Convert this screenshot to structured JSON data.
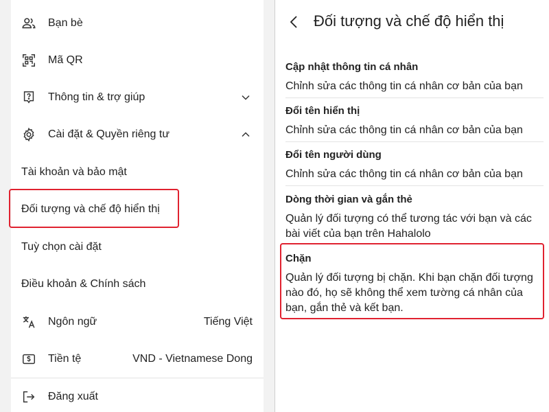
{
  "left_menu": {
    "friends": {
      "label": "Bạn bè",
      "icon": "friends-icon"
    },
    "qr": {
      "label": "Mã QR",
      "icon": "qr-code-icon"
    },
    "help": {
      "label": "Thông tin & trợ giúp",
      "icon": "help-icon"
    },
    "settings": {
      "label": "Cài đặt & Quyền riêng tư",
      "icon": "gear-icon"
    },
    "sub_account": {
      "label": "Tài khoản và bảo mật"
    },
    "sub_audience": {
      "label": "Đối tượng và chế độ hiển thị"
    },
    "sub_preferences": {
      "label": "Tuỳ chọn cài đặt"
    },
    "sub_terms": {
      "label": "Điều khoản & Chính sách"
    },
    "language": {
      "label": "Ngôn ngữ",
      "value": "Tiếng Việt",
      "icon": "translate-icon"
    },
    "currency": {
      "label": "Tiền tệ",
      "value": "VND - Vietnamese Dong",
      "icon": "currency-icon"
    },
    "logout": {
      "label": "Đăng xuất",
      "icon": "logout-icon"
    }
  },
  "right_panel": {
    "title": "Đối tượng và chế độ hiển thị",
    "sections": [
      {
        "title": "Cập nhật thông tin cá nhân",
        "desc": "Chỉnh sửa các thông tin cá nhân cơ bản của bạn"
      },
      {
        "title": "Đổi tên hiển thị",
        "desc": "Chỉnh sửa các thông tin cá nhân cơ bản của bạn"
      },
      {
        "title": "Đổi tên người dùng",
        "desc": "Chỉnh sửa các thông tin cá nhân cơ bản của bạn"
      },
      {
        "title": "Dòng thời gian và gắn thẻ",
        "desc": "Quản lý đối tượng có thể tương tác với bạn và các bài viết của bạn trên Hahalolo"
      },
      {
        "title": "Chặn",
        "desc": "Quản lý đối tượng bị chặn. Khi bạn chặn đối tượng nào đó, họ sẽ không thể xem tường cá nhân của bạn, gắn thẻ và kết bạn."
      }
    ]
  },
  "colors": {
    "highlight": "#e0212f",
    "divider": "#e3e3e3",
    "background": "#f2f2f2"
  }
}
